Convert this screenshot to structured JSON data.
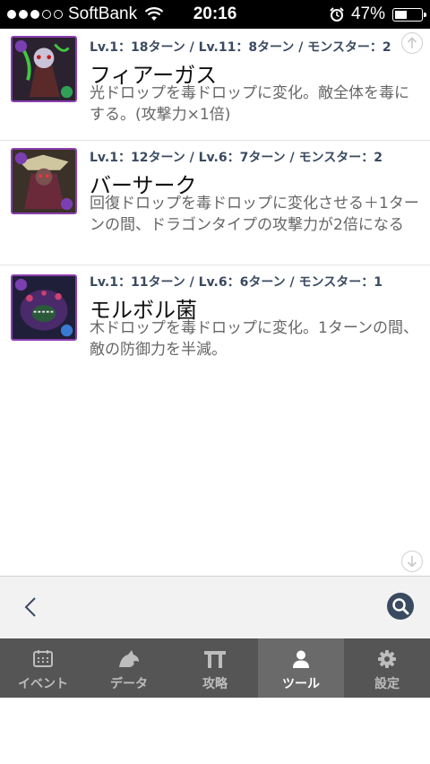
{
  "status_bar": {
    "carrier": "SoftBank",
    "time": "20:16",
    "battery": "47%",
    "battery_level": 0.47
  },
  "skills": [
    {
      "meta": "Lv.1：18ターン / Lv.11：8ターン / モンスター：2",
      "name": "フィアーガス",
      "description": "光ドロップを毒ドロップに変化。敵全体を毒にする。(攻撃力×1倍)",
      "thumb_icon": "monster-portrait-fear-gas"
    },
    {
      "meta": "Lv.1：12ターン / Lv.6：7ターン / モンスター：2",
      "name": "バーサーク",
      "description": "回復ドロップを毒ドロップに変化させる＋1ターンの間、ドラゴンタイプの攻撃力が2倍になる",
      "thumb_icon": "monster-portrait-berserk"
    },
    {
      "meta": "Lv.1：11ターン / Lv.6：6ターン / モンスター：1",
      "name": "モルボル菌",
      "description": "木ドロップを毒ドロップに変化。1ターンの間、敵の防御力を半減。",
      "thumb_icon": "monster-portrait-malboro"
    }
  ],
  "toolbar": {
    "back_icon": "chevron-left-icon",
    "search_icon": "search-icon"
  },
  "tabs": [
    {
      "label": "イベント",
      "icon": "calendar-icon",
      "active": false
    },
    {
      "label": "データ",
      "icon": "dragon-icon",
      "active": false
    },
    {
      "label": "攻略",
      "icon": "gate-icon",
      "active": false
    },
    {
      "label": "ツール",
      "icon": "person-icon",
      "active": true
    },
    {
      "label": "設定",
      "icon": "gear-icon",
      "active": false
    }
  ],
  "colors": {
    "accent": "#3a4a60",
    "tabbar_bg": "#555555",
    "tab_active_bg": "#6a6a6a",
    "thumb_border": "#8b3fb0"
  }
}
